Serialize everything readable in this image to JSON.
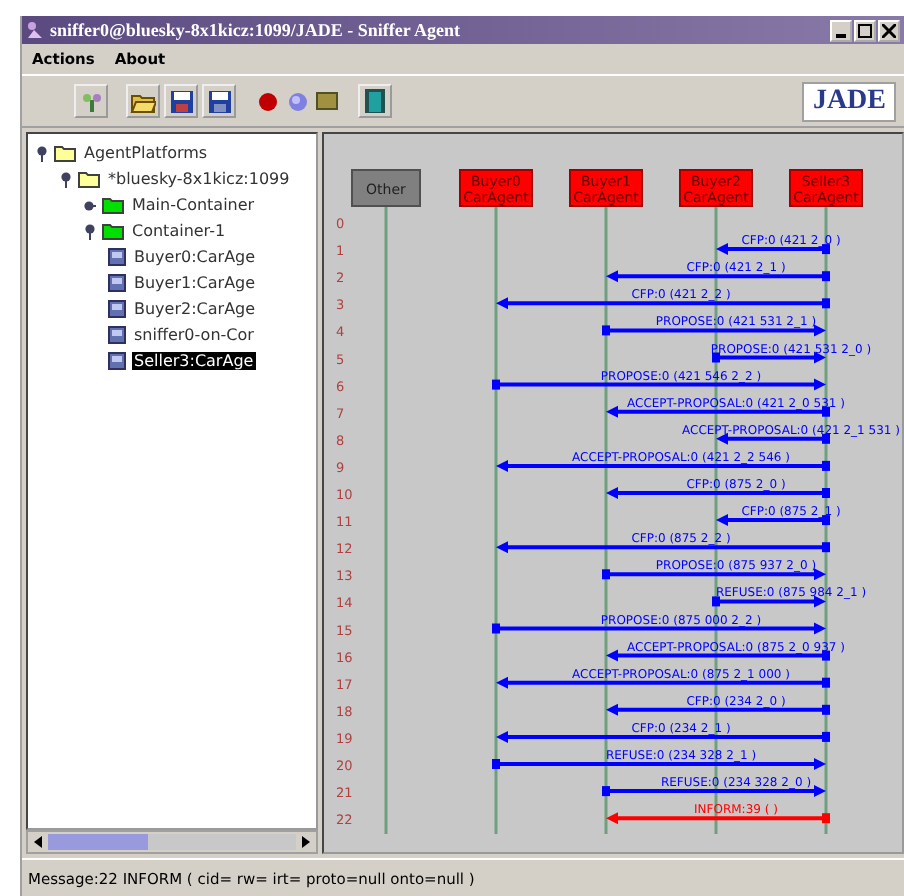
{
  "window": {
    "title": "sniffer0@bluesky-8x1kicz:1099/JADE - Sniffer Agent"
  },
  "menu": [
    "Actions",
    "About"
  ],
  "toolbar": {
    "logo": "JADE"
  },
  "tree": [
    {
      "label": "AgentPlatforms",
      "kind": "folder",
      "expanded": true,
      "selected": false,
      "children": [
        {
          "label": "*bluesky-8x1kicz:1099",
          "kind": "folder",
          "expanded": true,
          "selected": false,
          "children": [
            {
              "label": "Main-Container",
              "kind": "container",
              "expanded": false,
              "selected": false
            },
            {
              "label": "Container-1",
              "kind": "container",
              "expanded": true,
              "selected": false,
              "children": [
                {
                  "label": "Buyer0:CarAge",
                  "kind": "agent",
                  "selected": false
                },
                {
                  "label": "Buyer1:CarAge",
                  "kind": "agent",
                  "selected": false
                },
                {
                  "label": "Buyer2:CarAge",
                  "kind": "agent",
                  "selected": false
                },
                {
                  "label": "sniffer0-on-Cor",
                  "kind": "agent",
                  "selected": false
                },
                {
                  "label": "Seller3:CarAge",
                  "kind": "agent",
                  "selected": true
                }
              ]
            }
          ]
        }
      ]
    }
  ],
  "agents": [
    {
      "name": "Other",
      "kind": "other"
    },
    {
      "name": "Buyer0",
      "type": "CarAgent",
      "kind": "agent"
    },
    {
      "name": "Buyer1",
      "type": "CarAgent",
      "kind": "agent"
    },
    {
      "name": "Buyer2",
      "type": "CarAgent",
      "kind": "agent"
    },
    {
      "name": "Seller3",
      "type": "CarAgent",
      "kind": "agent"
    }
  ],
  "rows": [
    {
      "number": "0"
    },
    {
      "number": "1",
      "message": {
        "label": "CFP:0 (421 2_0 )",
        "color": "#0000ff",
        "lanes": [
          {
            "kind": "none"
          },
          {
            "kind": "none"
          },
          {
            "kind": "none"
          },
          {
            "kind": "head"
          },
          {
            "kind": "tail"
          }
        ]
      }
    },
    {
      "number": "2",
      "message": {
        "label": "CFP:0 (421 2_1 )",
        "color": "#0000ff",
        "lanes": [
          {
            "kind": "none"
          },
          {
            "kind": "none"
          },
          {
            "kind": "head"
          },
          {
            "kind": "none"
          },
          {
            "kind": "tail"
          }
        ]
      }
    },
    {
      "number": "3",
      "message": {
        "label": "CFP:0 (421 2_2 )",
        "color": "#0000ff",
        "lanes": [
          {
            "kind": "none"
          },
          {
            "kind": "head"
          },
          {
            "kind": "none"
          },
          {
            "kind": "none"
          },
          {
            "kind": "tail"
          }
        ]
      }
    },
    {
      "number": "4",
      "message": {
        "label": "PROPOSE:0 (421 531 2_1 )",
        "color": "#0000ff",
        "lanes": [
          {
            "kind": "none"
          },
          {
            "kind": "none"
          },
          {
            "kind": "tail"
          },
          {
            "kind": "none"
          },
          {
            "kind": "head"
          }
        ]
      }
    },
    {
      "number": "5",
      "message": {
        "label": "PROPOSE:0 (421 531 2_0 )",
        "color": "#0000ff",
        "lanes": [
          {
            "kind": "none"
          },
          {
            "kind": "none"
          },
          {
            "kind": "none"
          },
          {
            "kind": "tail"
          },
          {
            "kind": "head"
          }
        ]
      }
    },
    {
      "number": "6",
      "message": {
        "label": "PROPOSE:0 (421 546 2_2 )",
        "color": "#0000ff",
        "lanes": [
          {
            "kind": "none"
          },
          {
            "kind": "tail"
          },
          {
            "kind": "none"
          },
          {
            "kind": "none"
          },
          {
            "kind": "head"
          }
        ]
      }
    },
    {
      "number": "7",
      "message": {
        "label": "ACCEPT-PROPOSAL:0 (421 2_0 531 )",
        "color": "#0000ff",
        "lanes": [
          {
            "kind": "none"
          },
          {
            "kind": "none"
          },
          {
            "kind": "head"
          },
          {
            "kind": "none"
          },
          {
            "kind": "tail"
          }
        ]
      }
    },
    {
      "number": "8",
      "message": {
        "label": "ACCEPT-PROPOSAL:0 (421 2_1 531 )",
        "color": "#0000ff",
        "lanes": [
          {
            "kind": "none"
          },
          {
            "kind": "none"
          },
          {
            "kind": "none"
          },
          {
            "kind": "head"
          },
          {
            "kind": "tail"
          }
        ]
      }
    },
    {
      "number": "9",
      "message": {
        "label": "ACCEPT-PROPOSAL:0 (421 2_2 546 )",
        "color": "#0000ff",
        "lanes": [
          {
            "kind": "none"
          },
          {
            "kind": "head"
          },
          {
            "kind": "none"
          },
          {
            "kind": "none"
          },
          {
            "kind": "tail"
          }
        ]
      }
    },
    {
      "number": "10",
      "message": {
        "label": "CFP:0 (875 2_0 )",
        "color": "#0000ff",
        "lanes": [
          {
            "kind": "none"
          },
          {
            "kind": "none"
          },
          {
            "kind": "head"
          },
          {
            "kind": "none"
          },
          {
            "kind": "tail"
          }
        ]
      }
    },
    {
      "number": "11",
      "message": {
        "label": "CFP:0 (875 2_1 )",
        "color": "#0000ff",
        "lanes": [
          {
            "kind": "none"
          },
          {
            "kind": "none"
          },
          {
            "kind": "none"
          },
          {
            "kind": "head"
          },
          {
            "kind": "tail"
          }
        ]
      }
    },
    {
      "number": "12",
      "message": {
        "label": "CFP:0 (875 2_2 )",
        "color": "#0000ff",
        "lanes": [
          {
            "kind": "none"
          },
          {
            "kind": "head"
          },
          {
            "kind": "none"
          },
          {
            "kind": "none"
          },
          {
            "kind": "tail"
          }
        ]
      }
    },
    {
      "number": "13",
      "message": {
        "label": "PROPOSE:0 (875 937 2_0 )",
        "color": "#0000ff",
        "lanes": [
          {
            "kind": "none"
          },
          {
            "kind": "none"
          },
          {
            "kind": "tail"
          },
          {
            "kind": "none"
          },
          {
            "kind": "head"
          }
        ]
      }
    },
    {
      "number": "14",
      "message": {
        "label": "REFUSE:0 (875 984 2_1 )",
        "color": "#0000ff",
        "lanes": [
          {
            "kind": "none"
          },
          {
            "kind": "none"
          },
          {
            "kind": "none"
          },
          {
            "kind": "tail"
          },
          {
            "kind": "head"
          }
        ]
      }
    },
    {
      "number": "15",
      "message": {
        "label": "PROPOSE:0 (875 000 2_2 )",
        "color": "#0000ff",
        "lanes": [
          {
            "kind": "none"
          },
          {
            "kind": "tail"
          },
          {
            "kind": "none"
          },
          {
            "kind": "none"
          },
          {
            "kind": "head"
          }
        ]
      }
    },
    {
      "number": "16",
      "message": {
        "label": "ACCEPT-PROPOSAL:0 (875 2_0 937 )",
        "color": "#0000ff",
        "lanes": [
          {
            "kind": "none"
          },
          {
            "kind": "none"
          },
          {
            "kind": "head"
          },
          {
            "kind": "none"
          },
          {
            "kind": "tail"
          }
        ]
      }
    },
    {
      "number": "17",
      "message": {
        "label": "ACCEPT-PROPOSAL:0 (875 2_1 000 )",
        "color": "#0000ff",
        "lanes": [
          {
            "kind": "none"
          },
          {
            "kind": "head"
          },
          {
            "kind": "none"
          },
          {
            "kind": "none"
          },
          {
            "kind": "tail"
          }
        ]
      }
    },
    {
      "number": "18",
      "message": {
        "label": "CFP:0 (234 2_0 )",
        "color": "#0000ff",
        "lanes": [
          {
            "kind": "none"
          },
          {
            "kind": "none"
          },
          {
            "kind": "head"
          },
          {
            "kind": "none"
          },
          {
            "kind": "tail"
          }
        ]
      }
    },
    {
      "number": "19",
      "message": {
        "label": "CFP:0 (234 2_1 )",
        "color": "#0000ff",
        "lanes": [
          {
            "kind": "none"
          },
          {
            "kind": "head"
          },
          {
            "kind": "none"
          },
          {
            "kind": "none"
          },
          {
            "kind": "tail"
          }
        ]
      }
    },
    {
      "number": "20",
      "message": {
        "label": "REFUSE:0 (234 328 2_1 )",
        "color": "#0000ff",
        "lanes": [
          {
            "kind": "none"
          },
          {
            "kind": "tail"
          },
          {
            "kind": "none"
          },
          {
            "kind": "none"
          },
          {
            "kind": "head"
          }
        ]
      }
    },
    {
      "number": "21",
      "message": {
        "label": "REFUSE:0 (234 328 2_0 )",
        "color": "#0000ff",
        "lanes": [
          {
            "kind": "none"
          },
          {
            "kind": "none"
          },
          {
            "kind": "tail"
          },
          {
            "kind": "none"
          },
          {
            "kind": "head"
          }
        ]
      }
    },
    {
      "number": "22",
      "message": {
        "label": "INFORM:39 ( )",
        "color": "#ff0000",
        "lanes": [
          {
            "kind": "none"
          },
          {
            "kind": "none"
          },
          {
            "kind": "head"
          },
          {
            "kind": "none"
          },
          {
            "kind": "tail"
          }
        ]
      }
    }
  ],
  "status_bar": "Message:22 INFORM ( cid= rw= irt= proto=null onto=null )"
}
